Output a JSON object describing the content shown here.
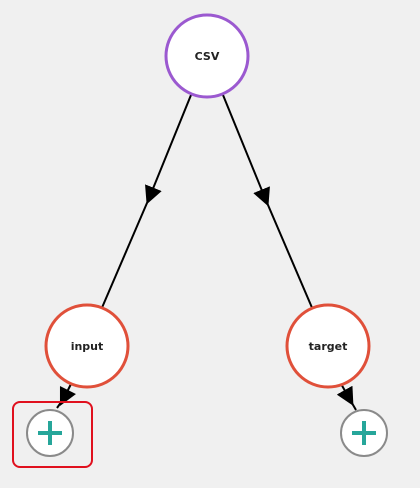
{
  "graph": {
    "nodes": [
      {
        "id": "csv",
        "label": "CSV",
        "stroke": "#9b59d0"
      },
      {
        "id": "input",
        "label": "input",
        "stroke": "#e0503a"
      },
      {
        "id": "target",
        "label": "target",
        "stroke": "#e0503a"
      }
    ],
    "add_buttons": [
      {
        "id": "add-input",
        "parent": "input",
        "icon": "plus-icon",
        "highlighted": true
      },
      {
        "id": "add-target",
        "parent": "target",
        "icon": "plus-icon",
        "highlighted": false
      }
    ],
    "edges": [
      {
        "from": "csv",
        "to": "input"
      },
      {
        "from": "csv",
        "to": "target"
      },
      {
        "from": "input",
        "to": "add-input"
      },
      {
        "from": "target",
        "to": "add-target"
      }
    ]
  },
  "colors": {
    "background": "#f0f0f0",
    "node_fill": "#ffffff",
    "edge": "#000000",
    "plus": "#26a69a",
    "plus_ring": "#8a8a8a",
    "highlight": "#e0101e"
  }
}
